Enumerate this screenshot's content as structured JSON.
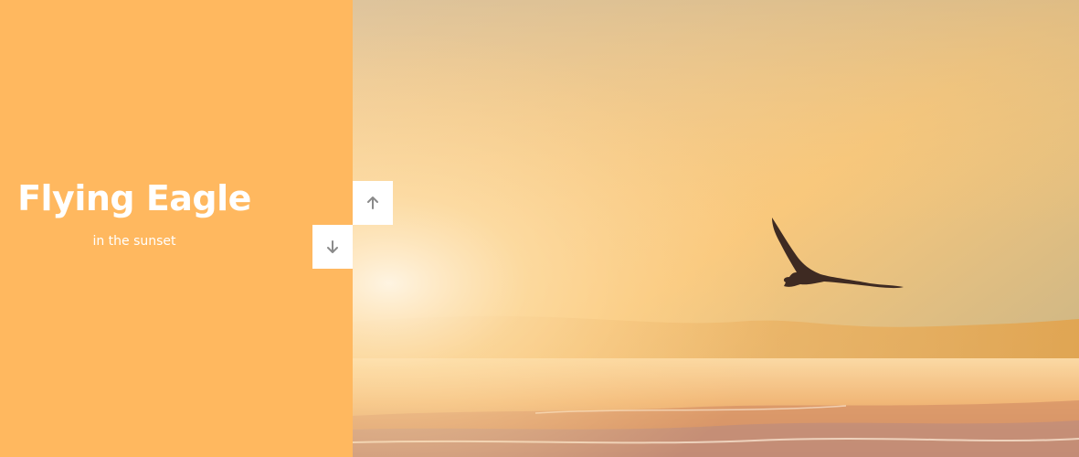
{
  "slide": {
    "title": "Flying Eagle",
    "subtitle": "in the sunset"
  },
  "controls": {
    "up_icon": "arrow-up-icon",
    "down_icon": "arrow-down-icon"
  },
  "colors": {
    "panel": "#ffb85f",
    "button": "#ffffff",
    "arrow": "#8a8a8a"
  }
}
